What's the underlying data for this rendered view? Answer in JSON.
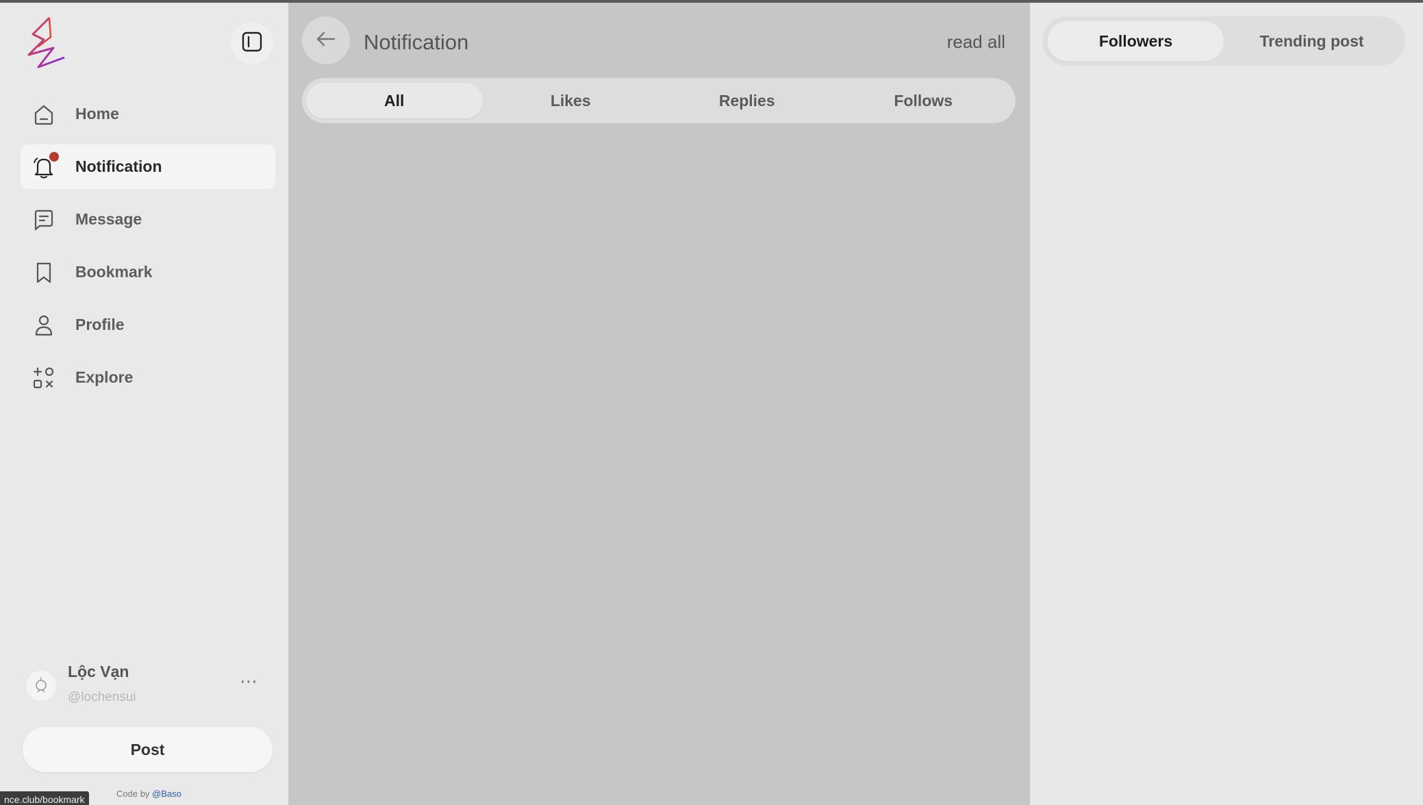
{
  "sidebar": {
    "nav": [
      {
        "label": "Home",
        "icon": "home-icon",
        "active": false
      },
      {
        "label": "Notification",
        "icon": "bell-icon",
        "active": true,
        "badge": true
      },
      {
        "label": "Message",
        "icon": "message-icon",
        "active": false
      },
      {
        "label": "Bookmark",
        "icon": "bookmark-icon",
        "active": false
      },
      {
        "label": "Profile",
        "icon": "user-icon",
        "active": false
      },
      {
        "label": "Explore",
        "icon": "explore-icon",
        "active": false
      }
    ],
    "user": {
      "name": "Lộc Vạn",
      "handle": "@lochensui"
    },
    "more_label": "⋯",
    "post_label": "Post",
    "credit": {
      "prefix": "Code by ",
      "link": "@Baso"
    },
    "status_url": "nce.club/bookmark"
  },
  "main": {
    "title": "Notification",
    "read_all": "read all",
    "tabs": [
      {
        "label": "All",
        "active": true
      },
      {
        "label": "Likes",
        "active": false
      },
      {
        "label": "Replies",
        "active": false
      },
      {
        "label": "Follows",
        "active": false
      }
    ]
  },
  "right": {
    "tabs": [
      {
        "label": "Followers",
        "active": true
      },
      {
        "label": "Trending post",
        "active": false
      }
    ]
  },
  "colors": {
    "accent_gradient": [
      "#e0443a",
      "#8a2be2"
    ],
    "badge": "#b83a2a",
    "credit_link": "#2d5fa8"
  }
}
